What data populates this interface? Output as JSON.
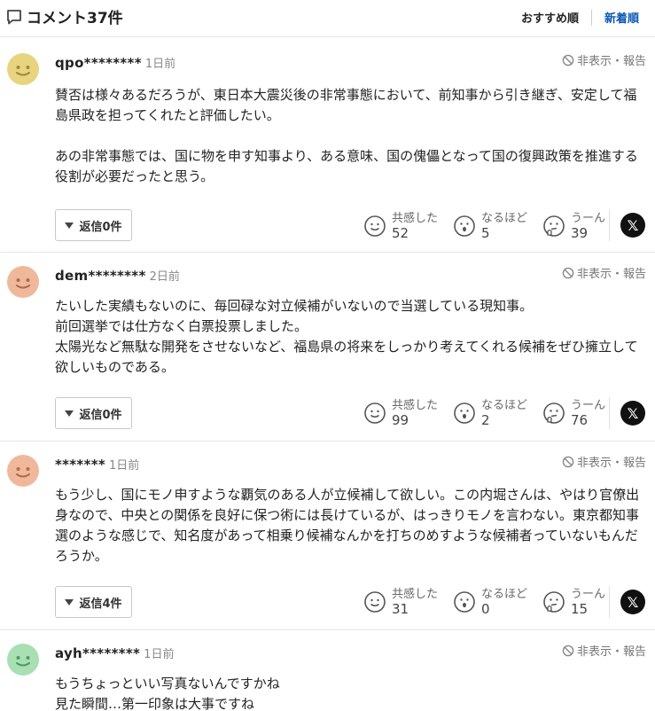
{
  "header": {
    "title": "コメント37件",
    "sort_recommended": "おすすめ順",
    "sort_newest": "新着順"
  },
  "report_label": "非表示・報告",
  "reaction_labels": {
    "agree": "共感した",
    "insight": "なるほど",
    "hmm": "うーん"
  },
  "x_label": "𝕏",
  "comments": [
    {
      "user": "qpo********",
      "time": "1日前",
      "avatar_color": "#e8d47e",
      "paragraphs": [
        "賛否は様々あるだろうが、東日本大震災後の非常事態において、前知事から引き継ぎ、安定して福島県政を担ってくれたと評価したい。",
        "",
        "あの非常事態では、国に物を申す知事より、ある意味、国の傀儡となって国の復興政策を推進する役割が必要だったと思う。"
      ],
      "reply": "返信0件",
      "agree": "52",
      "insight": "5",
      "hmm": "39"
    },
    {
      "user": "dem********",
      "time": "2日前",
      "avatar_color": "#f0b89a",
      "paragraphs": [
        "たいした実績もないのに、毎回碌な対立候補がいないので当選している現知事。",
        "前回選挙では仕方なく白票投票しました。",
        "太陽光など無駄な開発をさせないなど、福島県の将来をしっかり考えてくれる候補をぜひ擁立して欲しいものである。"
      ],
      "reply": "返信0件",
      "agree": "99",
      "insight": "2",
      "hmm": "76"
    },
    {
      "user": "*******",
      "time": "1日前",
      "avatar_color": "#f0b89a",
      "paragraphs": [
        "もう少し、国にモノ申すような覇気のある人が立候補して欲しい。この内堀さんは、やはり官僚出身なので、中央との関係を良好に保つ術には長けているが、はっきりモノを言わない。東京都知事選のような感じで、知名度があって相乗り候補なんかを打ちのめすような候補者っていないもんだろうか。"
      ],
      "reply": "返信4件",
      "agree": "31",
      "insight": "0",
      "hmm": "15"
    },
    {
      "user": "ayh********",
      "time": "1日前",
      "avatar_color": "#a9dfb3",
      "paragraphs": [
        "もうちょっといい写真ないんですかね",
        "見た瞬間…第一印象は大事ですね"
      ]
    }
  ]
}
